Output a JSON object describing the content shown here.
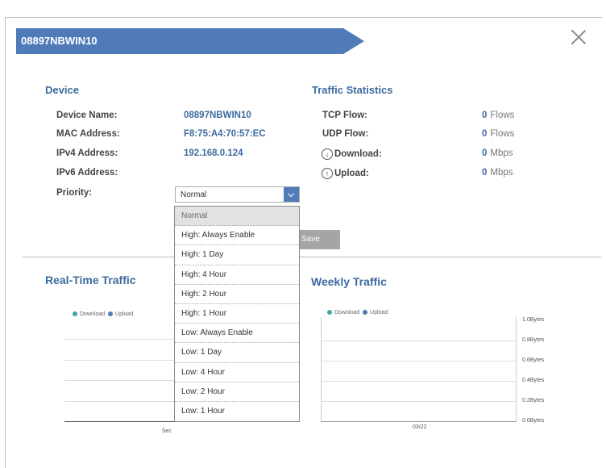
{
  "header": {
    "title": "08897NBWIN10"
  },
  "device": {
    "heading": "Device",
    "rows": [
      {
        "label": "Device Name:",
        "value": "08897NBWIN10"
      },
      {
        "label": "MAC Address:",
        "value": "F8:75:A4:70:57:EC"
      },
      {
        "label": "IPv4 Address:",
        "value": "192.168.0.124"
      },
      {
        "label": "IPv6 Address:",
        "value": ""
      }
    ],
    "priority_label": "Priority:",
    "priority_value": "Normal"
  },
  "traffic_stats": {
    "heading": "Traffic Statistics",
    "tcp_label": "TCP Flow:",
    "tcp_value": "0",
    "tcp_unit": "Flows",
    "udp_label": "UDP Flow:",
    "udp_value": "0",
    "udp_unit": "Flows",
    "download_label": "Download:",
    "download_value": "0",
    "download_unit": "Mbps",
    "upload_label": "Upload:",
    "upload_value": "0",
    "upload_unit": "Mbps"
  },
  "save_label": "Save",
  "realtime": {
    "heading": "Real-Time Traffic",
    "legend_download": "Download",
    "legend_upload": "Upload",
    "xlabel": "Sec"
  },
  "weekly": {
    "heading": "Weekly Traffic",
    "legend_download": "Download",
    "legend_upload": "Upload",
    "xlabel": "03/22",
    "yticks": [
      "1.0Bytes",
      "0.8Bytes",
      "0.6Bytes",
      "0.4Bytes",
      "0.2Bytes",
      "0.0Bytes"
    ]
  },
  "dropdown": {
    "options": [
      "Normal",
      "High: Always Enable",
      "High: 1 Day",
      "High: 4 Hour",
      "High: 2 Hour",
      "High: 1 Hour",
      "Low: Always Enable",
      "Low: 1 Day",
      "Low: 4 Hour",
      "Low: 2 Hour",
      "Low: 1 Hour"
    ],
    "selected_index": 0
  },
  "colors": {
    "accent": "#4f7bb8",
    "text_blue": "#3d6a9f",
    "download": "#3fa6a8",
    "upload": "#4f7bb8"
  }
}
